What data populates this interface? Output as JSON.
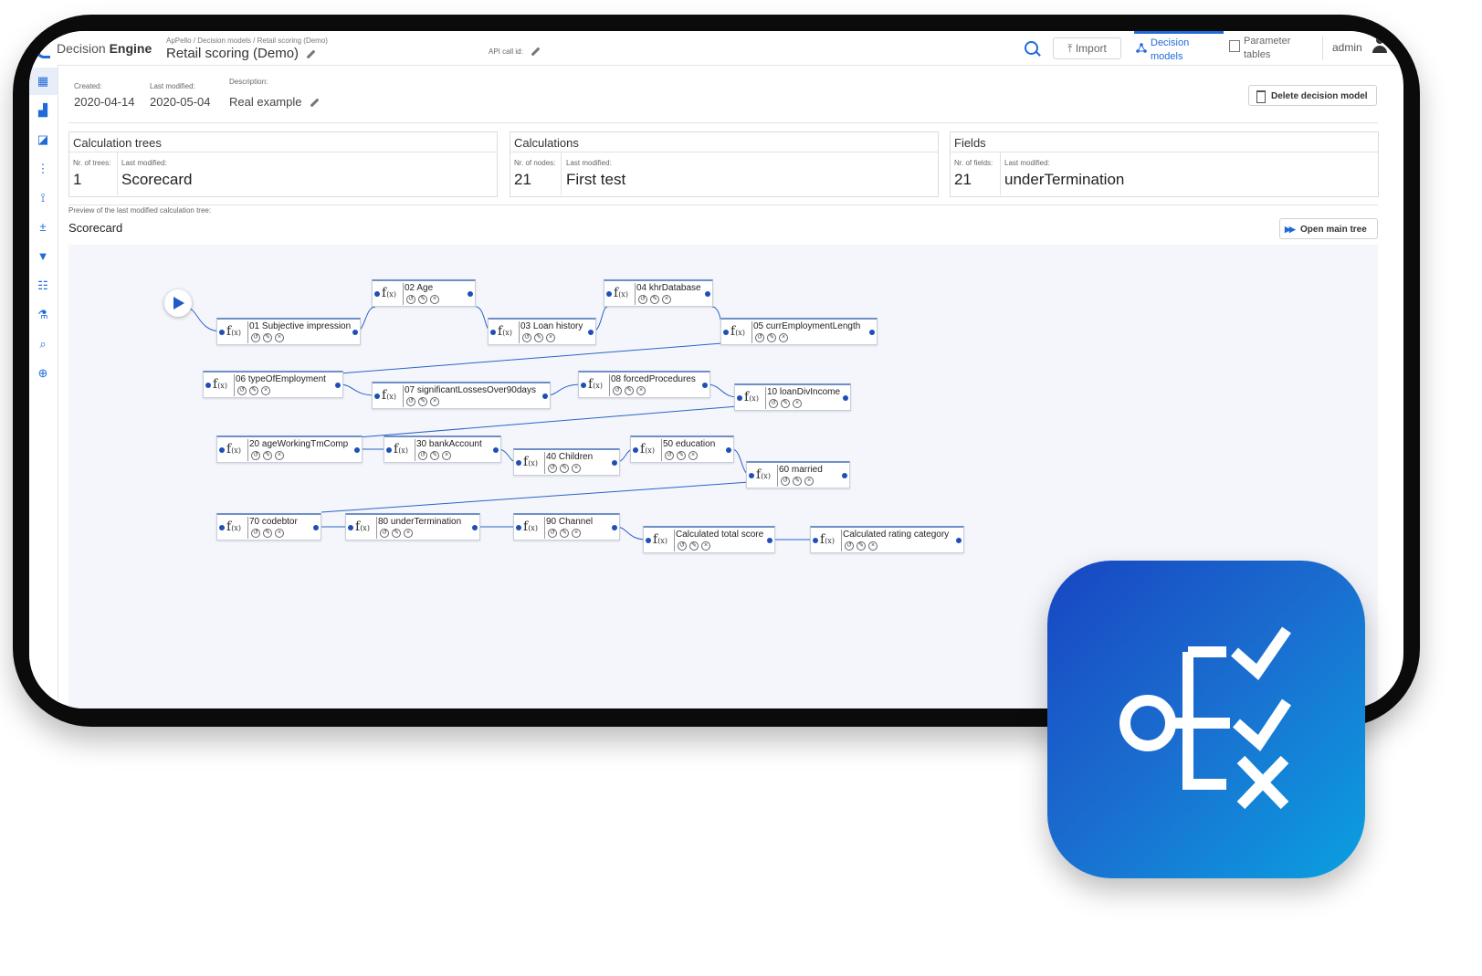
{
  "app": {
    "brand_prefix": "Decision",
    "brand_bold": "Engine",
    "breadcrumb": "ApPello  /  Decision models  /  Retail scoring (Demo)",
    "title": "Retail scoring (Demo)",
    "api_call_label": "API call id:"
  },
  "topnav": {
    "import_label": "Import",
    "decision_models_label_1": "Decision",
    "decision_models_label_2": "models",
    "parameter_tables_label_1": "Parameter",
    "parameter_tables_label_2": "tables",
    "user": "admin"
  },
  "meta": {
    "created_label": "Created:",
    "created_value": "2020-04-14",
    "modified_label": "Last modified:",
    "modified_value": "2020-05-04",
    "description_label": "Description:",
    "description_value": "Real example",
    "delete_button": "Delete decision model"
  },
  "panels": [
    {
      "title": "Calculation trees",
      "count_label": "Nr. of trees:",
      "count": "1",
      "modified_label": "Last modified:",
      "modified": "Scorecard"
    },
    {
      "title": "Calculations",
      "count_label": "Nr. of nodes:",
      "count": "21",
      "modified_label": "Last modified:",
      "modified": "First test"
    },
    {
      "title": "Fields",
      "count_label": "Nr. of fields:",
      "count": "21",
      "modified_label": "Last modified:",
      "modified": "underTermination"
    }
  ],
  "preview": {
    "label": "Preview of the last modified calculation tree:",
    "title": "Scorecard",
    "open_button": "Open main tree"
  },
  "nodes": [
    {
      "id": "n1",
      "name": "01 Subjective impression"
    },
    {
      "id": "n2",
      "name": "02 Age"
    },
    {
      "id": "n3",
      "name": "03 Loan history"
    },
    {
      "id": "n4",
      "name": "04 khrDatabase"
    },
    {
      "id": "n5",
      "name": "05 currEmploymentLength"
    },
    {
      "id": "n6",
      "name": "06 typeOfEmployment"
    },
    {
      "id": "n7",
      "name": "07 significantLossesOver90days"
    },
    {
      "id": "n8",
      "name": "08 forcedProcedures"
    },
    {
      "id": "n10",
      "name": "10 loanDivIncome"
    },
    {
      "id": "n20",
      "name": "20 ageWorkingTmComp"
    },
    {
      "id": "n30",
      "name": "30 bankAccount"
    },
    {
      "id": "n40",
      "name": "40 Children"
    },
    {
      "id": "n50",
      "name": "50 education"
    },
    {
      "id": "n60",
      "name": "60 married"
    },
    {
      "id": "n70",
      "name": "70 codebtor"
    },
    {
      "id": "n80",
      "name": "80 underTermination"
    },
    {
      "id": "n90",
      "name": "90 Channel"
    },
    {
      "id": "nts",
      "name": "Calculated total score"
    },
    {
      "id": "nrc",
      "name": "Calculated rating category"
    }
  ],
  "icons": {
    "sidebar": [
      "dashboard-icon",
      "chart-icon",
      "shapes-icon",
      "flow-icon",
      "tree-icon",
      "calc-icon",
      "filter-icon",
      "table-icon",
      "flask-icon",
      "search-icon",
      "zoom-icon"
    ],
    "app_badge": "decision-checklist-icon"
  },
  "colors": {
    "accent": "#1f6ad8",
    "badge_start": "#1846c2",
    "badge_end": "#0aa0e0"
  }
}
